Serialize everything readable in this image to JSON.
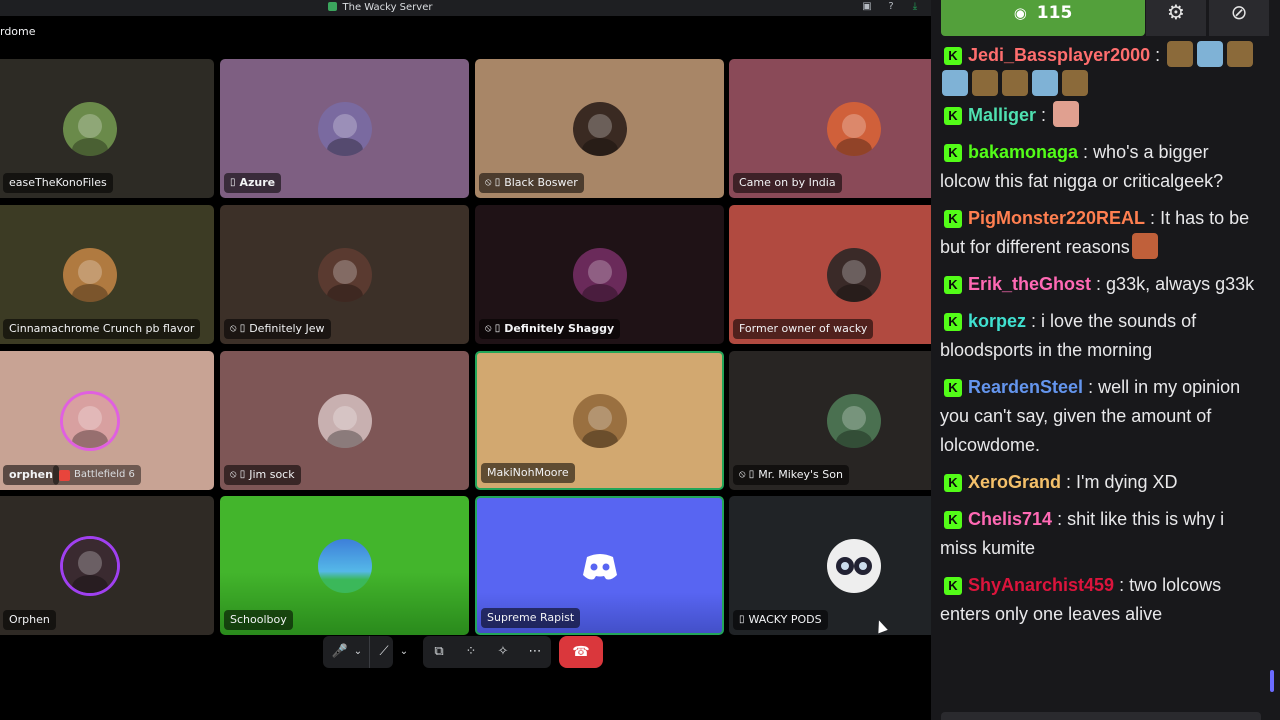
{
  "window": {
    "title": "The Wacky Server",
    "channel": "rdome"
  },
  "tiles": [
    {
      "name": "easeTheKonoFiles",
      "icons": "",
      "bg": "#2d2b25"
    },
    {
      "name": "Azure",
      "icons": "▯",
      "bg": "#7e5f82"
    },
    {
      "name": "Black Boswer",
      "icons": "⦸ ▯",
      "bg": "#a88667"
    },
    {
      "name": "Came on by India",
      "icons": "",
      "bg": "#8a4a58"
    },
    {
      "name": "Cinnamachrome Crunch pb flavor",
      "icons": "",
      "bg": "#3c3b24"
    },
    {
      "name": "Definitely Jew",
      "icons": "⦸ ▯",
      "bg": "#3c3028"
    },
    {
      "name": "Definitely Shaggy",
      "icons": "⦸ ▯",
      "bg": "#1f1216"
    },
    {
      "name": "Former owner of wacky",
      "icons": "",
      "bg": "#b14a40"
    },
    {
      "name": "orphen",
      "icons": "",
      "bg": "#c8a394",
      "game": "Battlefield 6"
    },
    {
      "name": "Jim sock",
      "icons": "⦸ ▯",
      "bg": "#7e5656"
    },
    {
      "name": "MakiNohMoore",
      "icons": "",
      "bg": "#d2a870"
    },
    {
      "name": "Mr. Mikey's Son",
      "icons": "⦸ ▯",
      "bg": "#282523"
    },
    {
      "name": "Orphen",
      "icons": "",
      "bg": "#2f2a25"
    },
    {
      "name": "Schoolboy",
      "icons": "",
      "bg": "#3faa2a"
    },
    {
      "name": "Supreme Rapist",
      "icons": "",
      "bg": "#5865f2"
    },
    {
      "name": "WACKY PODS",
      "icons": "▯",
      "bg": "#202326"
    }
  ],
  "controls": {
    "mic": "🎤",
    "mic_caret": "⌄",
    "camera": "⟋",
    "camera_caret": "⌄",
    "share": "⧉",
    "activities": "⁘",
    "soundboard": "✧",
    "more": "⋯",
    "end": "☎"
  },
  "chat": {
    "viewers": "115",
    "messages": [
      {
        "user": "Jedi_Bassplayer2000",
        "color": "#ff6e6e",
        "text": "",
        "emotes": [
          "#8b6a3a",
          "#7fb2d6",
          "#8b6a3a",
          "#7fb2d6",
          "#8b6a3a",
          "#8b6a3a",
          "#7fb2d6",
          "#8b6a3a"
        ]
      },
      {
        "user": "Malliger",
        "color": "#4fe0b0",
        "text": "",
        "emotes": [
          "#e0a090"
        ]
      },
      {
        "user": "bakamonaga",
        "color": "#53fc18",
        "text": "who's a bigger lolcow this fat nigga or criticalgeek?"
      },
      {
        "user": "PigMonster220REAL",
        "color": "#ff7f50",
        "text": "It has to be but for different reasons",
        "emotes": [
          "#c0603a"
        ]
      },
      {
        "user": "Erik_theGhost",
        "color": "#ff69b4",
        "text": "g33k, always g33k"
      },
      {
        "user": "korpez",
        "color": "#40e0d0",
        "text": "i love the sounds of bloodsports in the morning"
      },
      {
        "user": "ReardenSteel",
        "color": "#6495ed",
        "text": "well in my opinion you can't say, given the amount of lolcowdome."
      },
      {
        "user": "XeroGrand",
        "color": "#f4c06a",
        "text": "I'm dying XD"
      },
      {
        "user": "Chelis714",
        "color": "#ff69b4",
        "text": "shit like this is why i miss kumite"
      },
      {
        "user": "ShyAnarchist459",
        "color": "#dc143c",
        "text": "two lolcows enters only one leaves alive"
      }
    ]
  }
}
